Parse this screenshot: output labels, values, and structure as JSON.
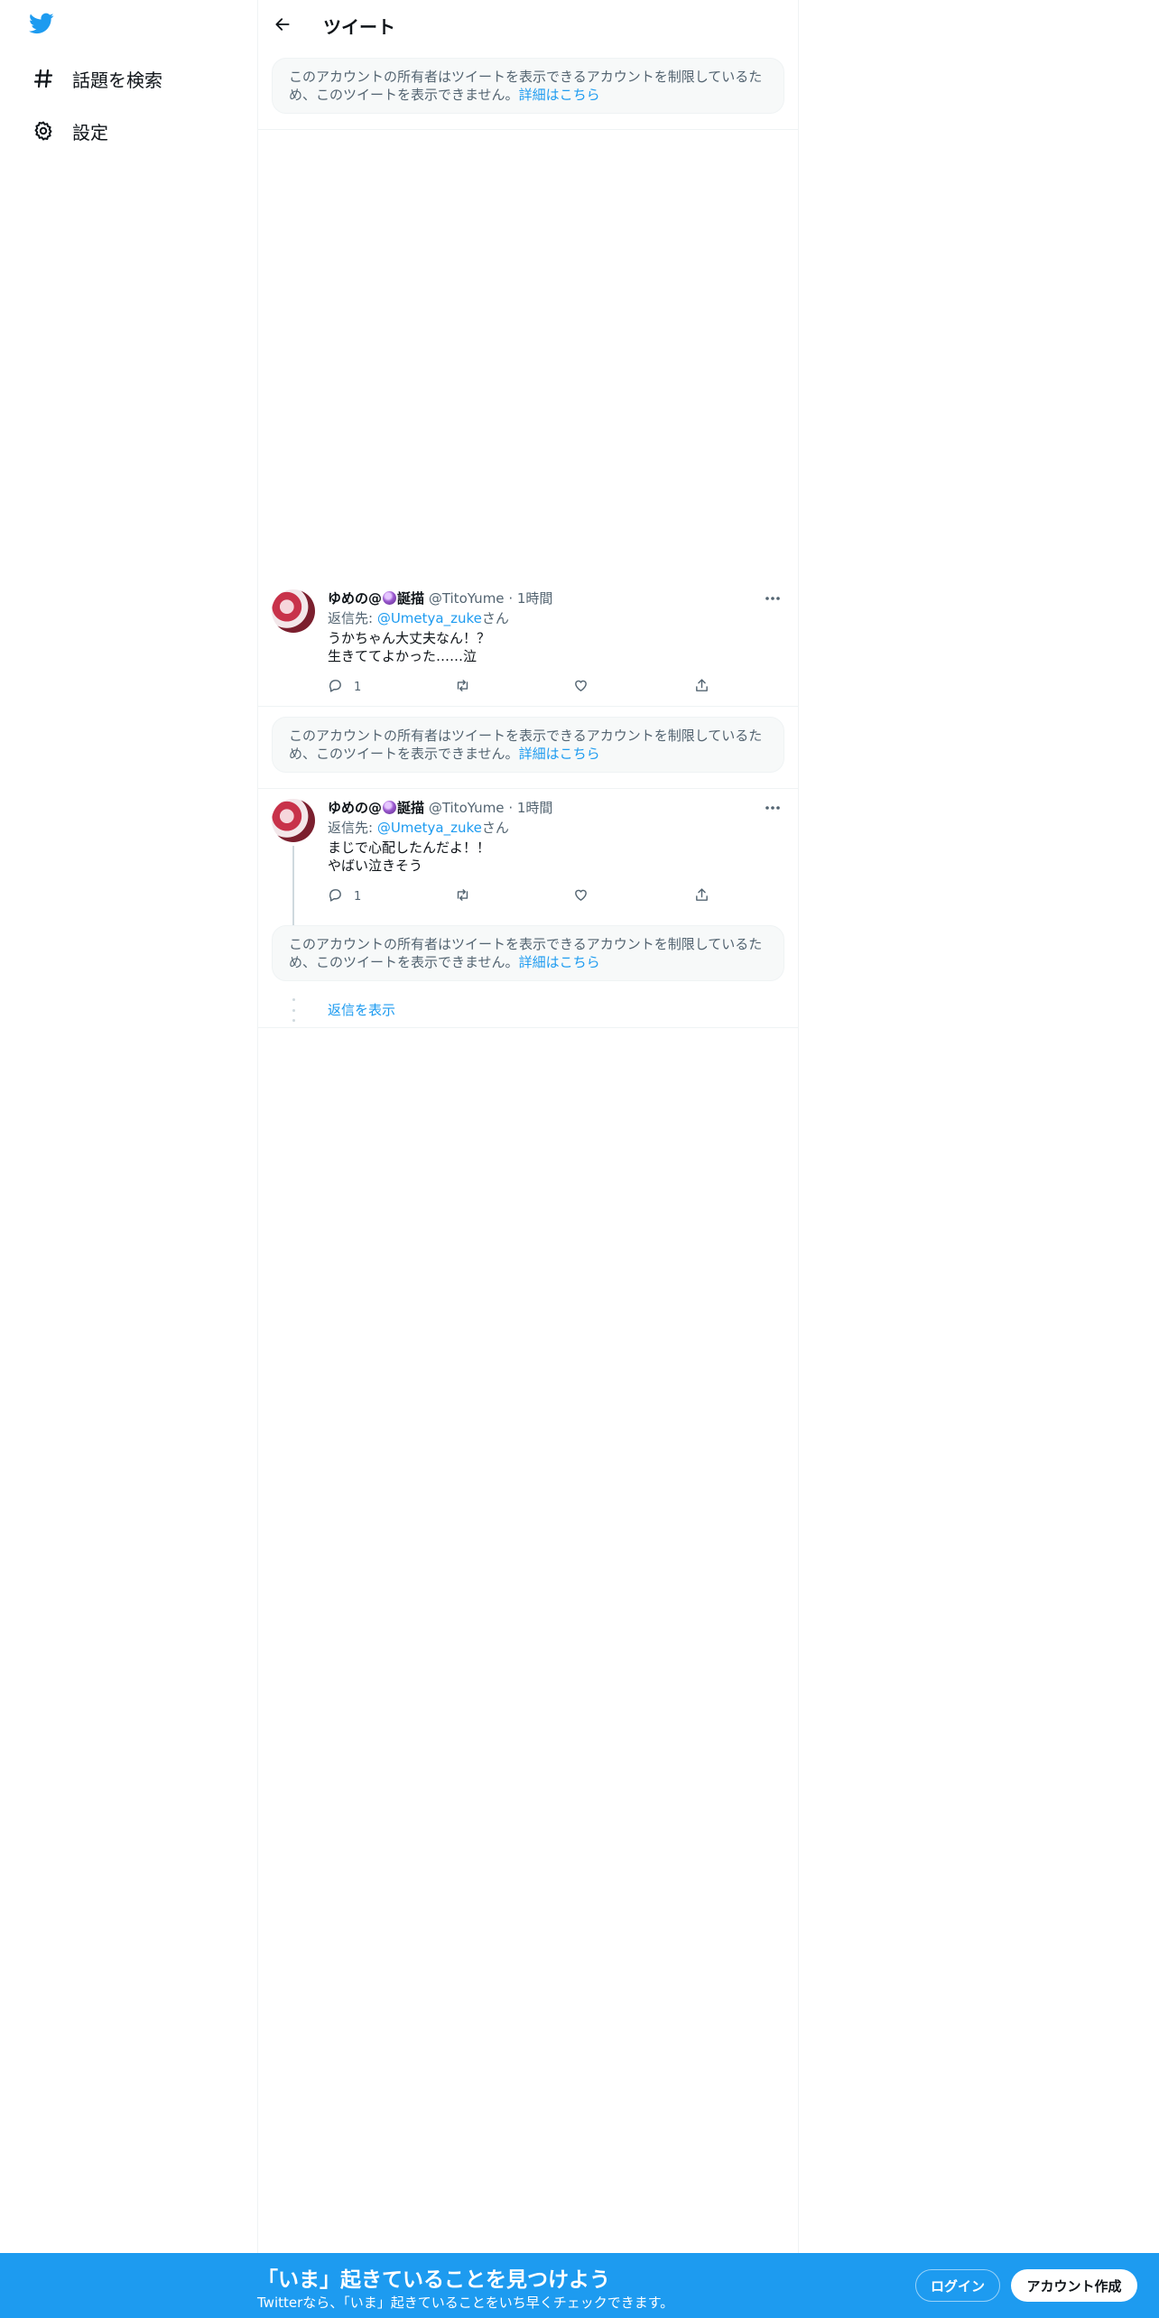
{
  "sidebar": {
    "logo": "twitter-bird-icon",
    "items": [
      {
        "label": "話題を検索",
        "icon": "hashtag-icon"
      },
      {
        "label": "設定",
        "icon": "gear-icon"
      }
    ]
  },
  "header": {
    "title": "ツイート"
  },
  "notice": {
    "text": "このアカウントの所有者はツイートを表示できるアカウントを制限しているため、このツイートを表示できません。",
    "link": "詳細はこちら"
  },
  "tweets": [
    {
      "name_prefix": "ゆめの@",
      "name_suffix": "誕描",
      "handle": "@TitoYume",
      "sep": "·",
      "time": "1時間",
      "reply_prefix": "返信先: ",
      "mention": "@Umetya_zuke",
      "reply_suffix": "さん",
      "line1": "うかちゃん大丈夫なん！？",
      "line2": "生きててよかった……泣",
      "reply_count": "1"
    },
    {
      "name_prefix": "ゆめの@",
      "name_suffix": "誕描",
      "handle": "@TitoYume",
      "sep": "·",
      "time": "1時間",
      "reply_prefix": "返信先: ",
      "mention": "@Umetya_zuke",
      "reply_suffix": "さん",
      "line1": "まじで心配したんだよ！！",
      "line2": "やばい泣きそう",
      "reply_count": "1"
    }
  ],
  "more_replies": "返信を表示",
  "bottom_bar": {
    "title": "「いま」起きていることを見つけよう",
    "subtitle": "Twitterなら、「いま」起きていることをいち早くチェックできます。",
    "login": "ログイン",
    "signup": "アカウント作成"
  },
  "colors": {
    "accent": "#1d9bf0",
    "secondary_text": "#536471",
    "border": "#eff3f4"
  }
}
